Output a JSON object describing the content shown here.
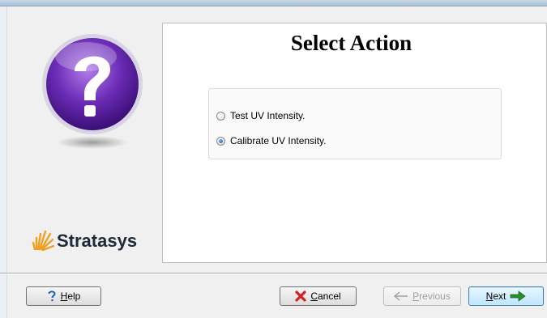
{
  "dialog": {
    "title": "Select Action",
    "logo_text": "Stratasys"
  },
  "options": [
    {
      "label": "Test UV Intensity.",
      "checked": false
    },
    {
      "label": "Calibrate UV Intensity.",
      "checked": true
    }
  ],
  "buttons": {
    "help": {
      "prefix": "",
      "mnemonic": "H",
      "rest": "elp"
    },
    "cancel": {
      "prefix": "",
      "mnemonic": "C",
      "rest": "ancel"
    },
    "previous": {
      "prefix": "",
      "mnemonic": "P",
      "rest": "revious",
      "disabled": true
    },
    "next": {
      "prefix": "",
      "mnemonic": "N",
      "rest": "ext"
    }
  },
  "colors": {
    "question_icon": "#6a2bb5",
    "cancel_icon": "#d42020",
    "next_arrow": "#2a8f2a",
    "logo_burst": "#f0a020"
  },
  "icons": [
    "question-mark-icon",
    "stratasys-logo-icon",
    "help-icon",
    "cancel-x-icon",
    "previous-arrow-icon",
    "next-arrow-icon"
  ]
}
